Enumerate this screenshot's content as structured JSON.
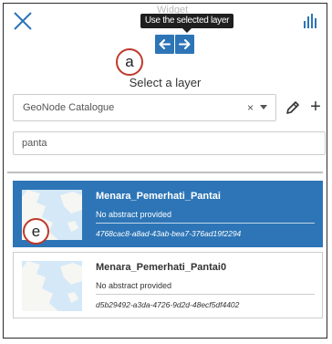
{
  "header": {
    "tooltip": "Use the selected layer",
    "hidden_title": "Widget",
    "prev_icon": "arrow-left-icon",
    "next_icon": "arrow-right-icon",
    "close_icon": "close-icon",
    "stats_icon": "bar-chart-icon"
  },
  "annotations": {
    "a": "a",
    "e": "e"
  },
  "section_label": "Select a layer",
  "catalog": {
    "selected": "GeoNode Catalogue",
    "clear_glyph": "×",
    "edit_icon": "pencil-icon",
    "add_icon": "plus-icon",
    "add_glyph": "+"
  },
  "search": {
    "value": "panta",
    "placeholder": ""
  },
  "results": [
    {
      "title": "Menara_Pemerhati_Pantai",
      "abstract": "No abstract provided",
      "id": "4768cac8-a8ad-43ab-bea7-376ad19f2294",
      "selected": true
    },
    {
      "title": "Menara_Pemerhati_Pantai0",
      "abstract": "No abstract provided",
      "id": "d5b29492-a3da-4726-9d2d-48ecf5df4402",
      "selected": false
    }
  ],
  "colors": {
    "accent": "#2d75b6",
    "annotation": "#c0392b",
    "tooltip_bg": "#1f1f1f"
  }
}
